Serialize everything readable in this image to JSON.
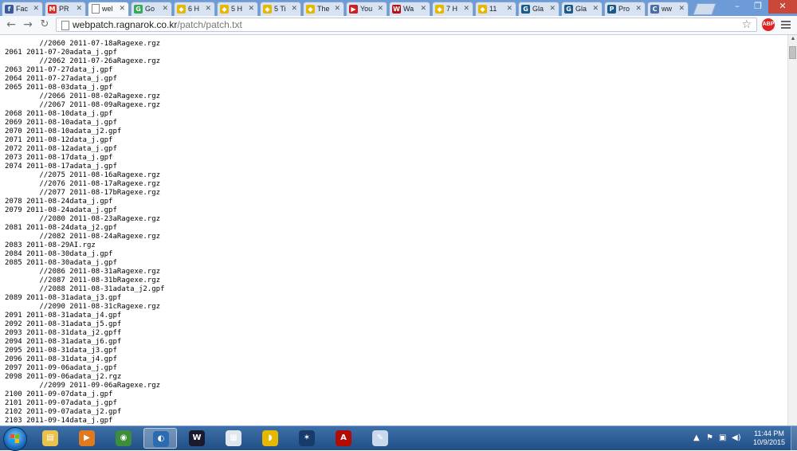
{
  "browser": {
    "tabs": [
      {
        "label": "Fac",
        "color": "#3b5998",
        "glyph": "f",
        "icon": "facebook-icon"
      },
      {
        "label": "PR",
        "color": "#d93025",
        "glyph": "M",
        "icon": "gmail-icon"
      },
      {
        "label": "wel",
        "color": "#ffffff",
        "glyph": "",
        "icon": "page-icon",
        "active": true
      },
      {
        "label": "Go",
        "color": "#34a853",
        "glyph": "G",
        "icon": "maps-icon"
      },
      {
        "label": "6 H",
        "color": "#e6b800",
        "glyph": "◆",
        "icon": "coin-icon"
      },
      {
        "label": "5 H",
        "color": "#e6b800",
        "glyph": "◆",
        "icon": "coin-icon"
      },
      {
        "label": "5 Ti",
        "color": "#e6b800",
        "glyph": "◆",
        "icon": "coin-icon"
      },
      {
        "label": "The",
        "color": "#e6b800",
        "glyph": "◆",
        "icon": "coin-icon"
      },
      {
        "label": "You",
        "color": "#cc2020",
        "glyph": "▶",
        "icon": "youtube-icon"
      },
      {
        "label": "Wa",
        "color": "#b5121b",
        "glyph": "W",
        "icon": "warframe-icon"
      },
      {
        "label": "7 H",
        "color": "#e6b800",
        "glyph": "◆",
        "icon": "coin-icon"
      },
      {
        "label": "11",
        "color": "#e6b800",
        "glyph": "◆",
        "icon": "coin-icon"
      },
      {
        "label": "Gla",
        "color": "#1a5a8a",
        "glyph": "G",
        "icon": "glassdoor-icon"
      },
      {
        "label": "Gla",
        "color": "#1a5a8a",
        "glyph": "G",
        "icon": "glassdoor-icon"
      },
      {
        "label": "Pro",
        "color": "#1a5a8a",
        "glyph": "P",
        "icon": "site-icon"
      },
      {
        "label": "ww",
        "color": "#4a6fa5",
        "glyph": "C",
        "icon": "loading-icon"
      }
    ],
    "address": {
      "host": "webpatch.ragnarok.co.kr",
      "path": "/patch/patch.txt"
    },
    "abp_label": "ABP"
  },
  "patch_lines": [
    "        //2060 2011-07-18aRagexe.rgz",
    "2061 2011-07-20adata_j.gpf",
    "        //2062 2011-07-26aRagexe.rgz",
    "2063 2011-07-27data_j.gpf",
    "2064 2011-07-27adata_j.gpf",
    "2065 2011-08-03data_j.gpf",
    "        //2066 2011-08-02aRagexe.rgz",
    "        //2067 2011-08-09aRagexe.rgz",
    "2068 2011-08-10data_j.gpf",
    "2069 2011-08-10adata_j.gpf",
    "2070 2011-08-10adata_j2.gpf",
    "2071 2011-08-12data_j.gpf",
    "2072 2011-08-12adata_j.gpf",
    "2073 2011-08-17data_j.gpf",
    "2074 2011-08-17adata_j.gpf",
    "        //2075 2011-08-16aRagexe.rgz",
    "        //2076 2011-08-17aRagexe.rgz",
    "        //2077 2011-08-17bRagexe.rgz",
    "2078 2011-08-24data_j.gpf",
    "2079 2011-08-24adata_j.gpf",
    "        //2080 2011-08-23aRagexe.rgz",
    "2081 2011-08-24data_j2.gpf",
    "        //2082 2011-08-24aRagexe.rgz",
    "2083 2011-08-29AI.rgz",
    "2084 2011-08-30data_j.gpf",
    "2085 2011-08-30adata_j.gpf",
    "        //2086 2011-08-31aRagexe.rgz",
    "        //2087 2011-08-31bRagexe.rgz",
    "        //2088 2011-08-31adata_j2.gpf",
    "2089 2011-08-31adata_j3.gpf",
    "        //2090 2011-08-31cRagexe.rgz",
    "2091 2011-08-31adata_j4.gpf",
    "2092 2011-08-31adata_j5.gpf",
    "2093 2011-08-31data_j2.gpff",
    "2094 2011-08-31adata_j6.gpf",
    "2095 2011-08-31data_j3.gpf",
    "2096 2011-08-31data_j4.gpf",
    "2097 2011-09-06adata_j.gpf",
    "2098 2011-09-06adata_j2.rgz",
    "        //2099 2011-09-06aRagexe.rgz",
    "2100 2011-09-07data_j.gpf",
    "2101 2011-09-07adata_j.gpf",
    "2102 2011-09-07adata_j2.gpf",
    "2103 2011-09-14data_j.gpf"
  ],
  "taskbar": {
    "apps": [
      {
        "name": "explorer-icon",
        "color": "#e8c24a",
        "glyph": "▤"
      },
      {
        "name": "media-player-icon",
        "color": "#e07a1f",
        "glyph": "▶"
      },
      {
        "name": "chrome-icon",
        "color": "#3c8d3c",
        "glyph": "◉"
      },
      {
        "name": "ragnarok-icon",
        "color": "#2b6cb0",
        "glyph": "◐",
        "active": true
      },
      {
        "name": "winamp-icon",
        "color": "#1a1a2e",
        "glyph": "W"
      },
      {
        "name": "calendar-icon",
        "color": "#dfe6ee",
        "glyph": "▦"
      },
      {
        "name": "banana-icon",
        "color": "#e6b800",
        "glyph": "◗"
      },
      {
        "name": "arcade-icon",
        "color": "#173b6b",
        "glyph": "✶"
      },
      {
        "name": "acrobat-icon",
        "color": "#b30b00",
        "glyph": "A"
      },
      {
        "name": "paint-icon",
        "color": "#c9d8ea",
        "glyph": "✎"
      }
    ],
    "clock_time": "11:44 PM",
    "clock_date": "10/9/2015"
  }
}
